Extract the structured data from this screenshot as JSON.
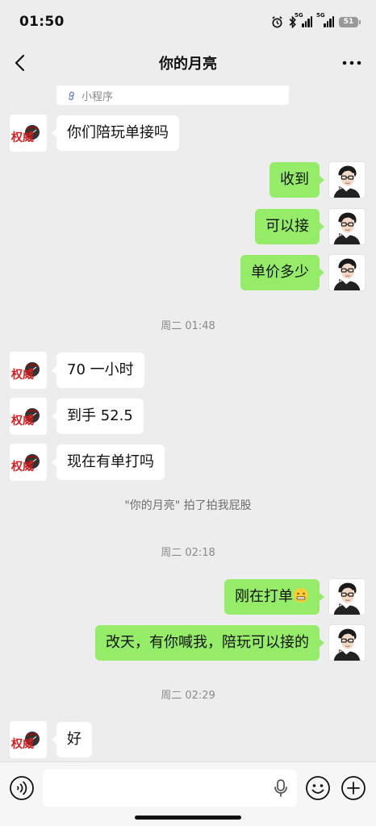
{
  "status_bar": {
    "time": "01:50",
    "battery": "51",
    "sig1_label": "5G",
    "sig2_label": "5G"
  },
  "nav": {
    "title": "你的月亮"
  },
  "mini_program": {
    "label": "小程序"
  },
  "avatars": {
    "left_logo_text": "权威"
  },
  "messages": [
    {
      "dir": "in",
      "text": "你们陪玩单接吗"
    },
    {
      "dir": "out",
      "text": "收到"
    },
    {
      "dir": "out",
      "text": "可以接"
    },
    {
      "dir": "out",
      "text": "单价多少"
    },
    {
      "dir": "in",
      "text": "70 一小时"
    },
    {
      "dir": "in",
      "text": "到手 52.5"
    },
    {
      "dir": "in",
      "text": "现在有单打吗"
    },
    {
      "dir": "out",
      "text": "刚在打单"
    },
    {
      "dir": "out",
      "text": "改天，有你喊我，陪玩可以接的"
    },
    {
      "dir": "in",
      "text": "好"
    }
  ],
  "timestamps": [
    "周二 01:48",
    "周二 02:18",
    "周二 02:29"
  ],
  "system_notice": "\"你的月亮\" 拍了拍我屁股",
  "colors": {
    "bubble_out": "#95ec69",
    "bubble_in": "#ffffff",
    "background": "#ededed"
  },
  "icons": {
    "back": "chevron-left-icon",
    "more": "more-icon",
    "voice": "voice-icon",
    "mic": "mic-icon",
    "emoji": "emoji-icon",
    "plus": "plus-icon"
  }
}
